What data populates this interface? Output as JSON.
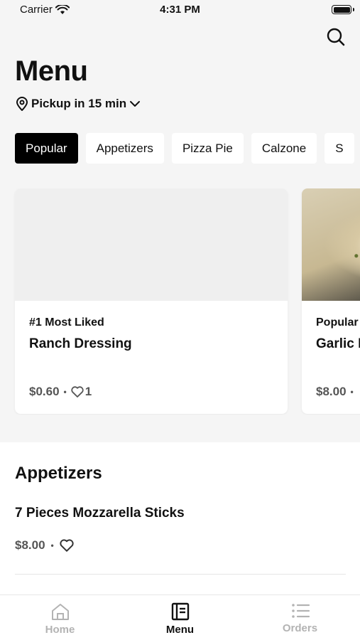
{
  "status_bar": {
    "carrier": "Carrier",
    "time": "4:31 PM"
  },
  "header": {
    "title": "Menu",
    "pickup_label": "Pickup in 15 min"
  },
  "category_tabs": [
    {
      "label": "Popular",
      "active": true
    },
    {
      "label": "Appetizers",
      "active": false
    },
    {
      "label": "Pizza Pie",
      "active": false
    },
    {
      "label": "Calzone",
      "active": false
    },
    {
      "label": "S",
      "active": false
    }
  ],
  "featured_cards": [
    {
      "tag": "#1 Most Liked",
      "name": "Ranch Dressing",
      "price": "$0.60",
      "likes": "1"
    },
    {
      "tag": "Popular",
      "name": "Garlic K",
      "price": "$8.00",
      "likes": ""
    }
  ],
  "sections": [
    {
      "title": "Appetizers",
      "items": [
        {
          "name": "7 Pieces Mozzarella Sticks",
          "price": "$8.00"
        }
      ]
    }
  ],
  "tabbar": [
    {
      "label": "Home",
      "icon": "home-icon",
      "active": false
    },
    {
      "label": "Menu",
      "icon": "menu-book-icon",
      "active": true
    },
    {
      "label": "Orders",
      "icon": "list-icon",
      "active": false
    }
  ],
  "colors": {
    "accent": "#000000",
    "background": "#f5f5f5",
    "inactive": "#b3b3b3"
  }
}
